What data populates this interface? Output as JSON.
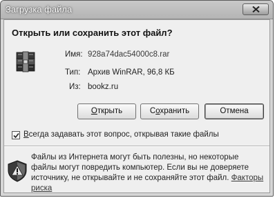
{
  "window": {
    "title": "Загрузка файла",
    "close_icon": "close-icon"
  },
  "dialog": {
    "heading": "Открыть или сохранить этот файл?",
    "name_label": "Имя:",
    "name_value": "928a74dac54000c8.rar",
    "type_label": "Тип:",
    "type_value": "Архив WinRAR, 96,8 КБ",
    "from_label": "Из:",
    "from_value": "bookz.ru",
    "file_icon": "winrar-archive-icon"
  },
  "buttons": {
    "open_accel": "О",
    "open_rest": "ткрыть",
    "save_pre": "С",
    "save_accel": "о",
    "save_rest": "хранить",
    "cancel": "Отмена"
  },
  "checkbox": {
    "checked": true,
    "label_accel": "В",
    "label_rest": "сегда задавать этот вопрос, открывая такие файлы"
  },
  "warning": {
    "icon": "shield-warning-icon",
    "text": "Файлы из Интернета могут быть полезны, но некоторые файлы могут повредить компьютер. Если вы не доверяете источнику, не открывайте и не сохраняйте этот файл.",
    "link": "Факторы риска"
  }
}
